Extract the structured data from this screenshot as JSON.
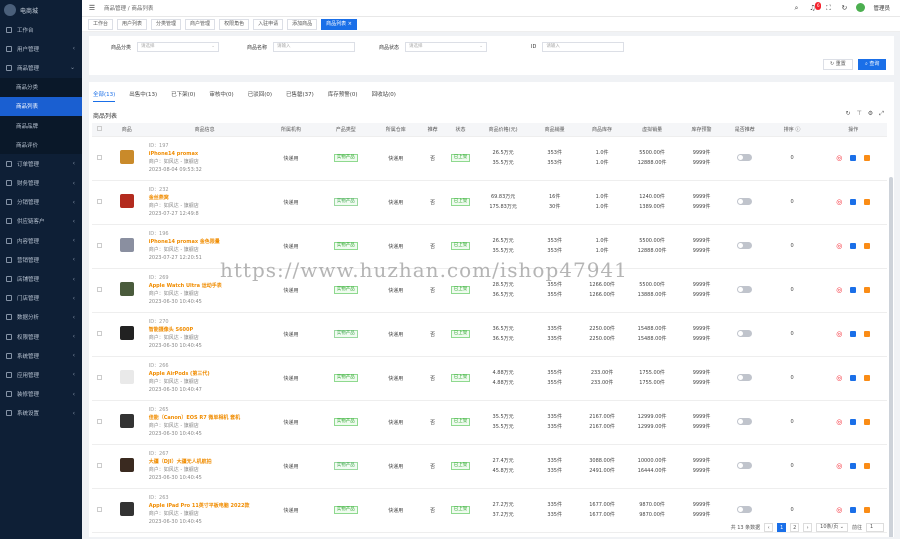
{
  "sidebar": {
    "brand": "电商城",
    "items": [
      {
        "label": "工作台",
        "arrow": ""
      },
      {
        "label": "用户管理",
        "arrow": "‹"
      },
      {
        "label": "商品管理",
        "arrow": "⌄"
      },
      {
        "label": "商品分类",
        "arrow": "",
        "sub": true
      },
      {
        "label": "商品列表",
        "arrow": "",
        "sub": true,
        "active": true
      },
      {
        "label": "商品品牌",
        "arrow": "",
        "sub": true
      },
      {
        "label": "商品评价",
        "arrow": "",
        "sub": true
      },
      {
        "label": "订单管理",
        "arrow": "‹"
      },
      {
        "label": "财务管理",
        "arrow": "‹"
      },
      {
        "label": "分销管理",
        "arrow": "‹"
      },
      {
        "label": "供应链客户",
        "arrow": "‹"
      },
      {
        "label": "内容管理",
        "arrow": "‹"
      },
      {
        "label": "营销管理",
        "arrow": "‹"
      },
      {
        "label": "店铺管理",
        "arrow": "‹"
      },
      {
        "label": "门店管理",
        "arrow": "‹"
      },
      {
        "label": "数据分析",
        "arrow": "‹"
      },
      {
        "label": "权限管理",
        "arrow": "‹"
      },
      {
        "label": "系统管理",
        "arrow": "‹"
      },
      {
        "label": "应用管理",
        "arrow": "‹"
      },
      {
        "label": "装修管理",
        "arrow": "‹"
      },
      {
        "label": "系统设置",
        "arrow": "‹"
      }
    ]
  },
  "topbar": {
    "menu_icon": "☰",
    "breadcrumb": "商品管理 / 商品列表",
    "notice_count": "6",
    "username": "管理员"
  },
  "page_tabs": [
    {
      "label": "工作台"
    },
    {
      "label": "用户列表"
    },
    {
      "label": "分类管理"
    },
    {
      "label": "商户管理"
    },
    {
      "label": "权限角色"
    },
    {
      "label": "入驻申请"
    },
    {
      "label": "添加商品"
    },
    {
      "label": "商品列表 ×",
      "active": true
    }
  ],
  "filter": {
    "cat_label": "商品分类",
    "cat_placeholder": "请选择",
    "name_label": "商品名称",
    "name_placeholder": "请输入",
    "merch_label": "商品状态",
    "merch_placeholder": "请选择",
    "id_label": "ID",
    "id_placeholder": "请输入",
    "reset": "↻ 重置",
    "search": "⌕ 查询"
  },
  "status_tabs": [
    {
      "label": "全部(13)",
      "active": true
    },
    {
      "label": "出售中(13)"
    },
    {
      "label": "已下架(0)"
    },
    {
      "label": "审核中(0)"
    },
    {
      "label": "已驳回(0)"
    },
    {
      "label": "已售罄(37)"
    },
    {
      "label": "库存预警(0)"
    },
    {
      "label": "回收站(0)"
    }
  ],
  "list_title": "商品列表",
  "columns": [
    "",
    "商品",
    "商品信息",
    "所属机构",
    "产品类型",
    "所属仓库",
    "推荐",
    "状态",
    "商品价格(元)",
    "商品销量",
    "商品库存",
    "虚拟销量",
    "库存预警",
    "是否推荐",
    "排序 ⓘ",
    "操作"
  ],
  "rows": [
    {
      "id": "ID：197",
      "name": "iPhone14 promax",
      "sub": "商户：如风达 - 旗舰店",
      "date": "2023-08-04 09:53:32",
      "org": "快递用",
      "type": "实物产品",
      "wh": "快递用",
      "rec": "否",
      "status": "已上架",
      "p1": "26.5万元",
      "p2": "35.5万元",
      "s1": "353件",
      "s2": "353件",
      "k1": "1.0件",
      "k2": "1.0件",
      "v1": "5500.00件",
      "v2": "12888.00件",
      "w1": "9999件",
      "w2": "9999件",
      "sort": "0",
      "color": "#c98a2a"
    },
    {
      "id": "ID：232",
      "name": "金丝燕窝",
      "sub": "商户：如风达 - 旗舰店",
      "date": "2023-07-27 12:49:8",
      "org": "快递用",
      "type": "实物产品",
      "wh": "快递用",
      "rec": "否",
      "status": "已上架",
      "p1": "69.83万元",
      "p2": "175.83万元",
      "s1": "16件",
      "s2": "30件",
      "k1": "1.0件",
      "k2": "1.0件",
      "v1": "1240.00件",
      "v2": "1389.00件",
      "w1": "9999件",
      "w2": "9999件",
      "sort": "0",
      "color": "#b32b1e"
    },
    {
      "id": "ID：196",
      "name": "iPhone14 promax 金色限量",
      "sub": "商户：如风达 - 旗舰店",
      "date": "2023-07-27 12:20:51",
      "org": "快递用",
      "type": "实物产品",
      "wh": "快递用",
      "rec": "否",
      "status": "已上架",
      "p1": "26.5万元",
      "p2": "35.5万元",
      "s1": "353件",
      "s2": "353件",
      "k1": "1.0件",
      "k2": "1.0件",
      "v1": "5500.00件",
      "v2": "12888.00件",
      "w1": "9999件",
      "w2": "9999件",
      "sort": "0",
      "color": "#8a8fa0"
    },
    {
      "id": "ID：269",
      "name": "Apple Watch Ultra 运动手表",
      "sub": "商户：如风达 - 旗舰店",
      "date": "2023-06-30 10:40:45",
      "org": "快递用",
      "type": "实物产品",
      "wh": "快递用",
      "rec": "否",
      "status": "已上架",
      "p1": "28.5万元",
      "p2": "36.5万元",
      "s1": "355件",
      "s2": "355件",
      "k1": "1266.00件",
      "k2": "1266.00件",
      "v1": "5500.00件",
      "v2": "13888.00件",
      "w1": "9999件",
      "w2": "9999件",
      "sort": "0",
      "color": "#4a5b3c"
    },
    {
      "id": "ID：270",
      "name": "智能摄像头 S600P",
      "sub": "商户：如风达 - 旗舰店",
      "date": "2023-06-30 10:40:45",
      "org": "快递用",
      "type": "实物产品",
      "wh": "快递用",
      "rec": "否",
      "status": "已上架",
      "p1": "36.5万元",
      "p2": "36.5万元",
      "s1": "335件",
      "s2": "335件",
      "k1": "2250.00件",
      "k2": "2250.00件",
      "v1": "15488.00件",
      "v2": "15488.00件",
      "w1": "9999件",
      "w2": "9999件",
      "sort": "0",
      "color": "#222"
    },
    {
      "id": "ID：266",
      "name": "Apple AirPods (第三代)",
      "sub": "商户：如风达 - 旗舰店",
      "date": "2023-06-30 10:40:47",
      "org": "快递用",
      "type": "实物产品",
      "wh": "快递用",
      "rec": "否",
      "status": "已上架",
      "p1": "4.88万元",
      "p2": "4.88万元",
      "s1": "355件",
      "s2": "355件",
      "k1": "233.00件",
      "k2": "233.00件",
      "v1": "1755.00件",
      "v2": "1755.00件",
      "w1": "9999件",
      "w2": "9999件",
      "sort": "0",
      "color": "#e9e9e9"
    },
    {
      "id": "ID：265",
      "name": "佳能（Canon）EOS R7 微单相机 套机",
      "sub": "商户：如风达 - 旗舰店",
      "date": "2023-06-30 10:40:45",
      "org": "快递用",
      "type": "实物产品",
      "wh": "快递用",
      "rec": "否",
      "status": "已上架",
      "p1": "35.5万元",
      "p2": "35.5万元",
      "s1": "335件",
      "s2": "335件",
      "k1": "2167.00件",
      "k2": "2167.00件",
      "v1": "12999.00件",
      "v2": "12999.00件",
      "w1": "9999件",
      "w2": "9999件",
      "sort": "0",
      "color": "#333"
    },
    {
      "id": "ID：267",
      "name": "大疆（DJI）大疆无人机航拍",
      "sub": "商户：如风达 - 旗舰店",
      "date": "2023-06-30 10:40:45",
      "org": "快递用",
      "type": "实物产品",
      "wh": "快递用",
      "rec": "否",
      "status": "已上架",
      "p1": "27.4万元",
      "p2": "45.8万元",
      "s1": "335件",
      "s2": "335件",
      "k1": "3088.00件",
      "k2": "2491.00件",
      "v1": "10000.00件",
      "v2": "16444.00件",
      "w1": "9999件",
      "w2": "9999件",
      "sort": "0",
      "color": "#3a2a20"
    },
    {
      "id": "ID：263",
      "name": "Apple iPad Pro 11英寸平板电脑 2022款",
      "sub": "商户：如风达 - 旗舰店",
      "date": "2023-06-30 10:40:45",
      "org": "快递用",
      "type": "实物产品",
      "wh": "快递用",
      "rec": "否",
      "status": "已上架",
      "p1": "27.2万元",
      "p2": "37.2万元",
      "s1": "335件",
      "s2": "335件",
      "k1": "1677.00件",
      "k2": "1677.00件",
      "v1": "9870.00件",
      "v2": "9870.00件",
      "w1": "9999件",
      "w2": "9999件",
      "sort": "0",
      "color": "#333"
    }
  ],
  "pager": {
    "total": "共 13 条数据",
    "p1": "1",
    "p2": "2",
    "size": "10条/页 ⌄",
    "goto": "前往",
    "page": "1"
  },
  "watermark": "https://www.huzhan.com/ishop47941"
}
